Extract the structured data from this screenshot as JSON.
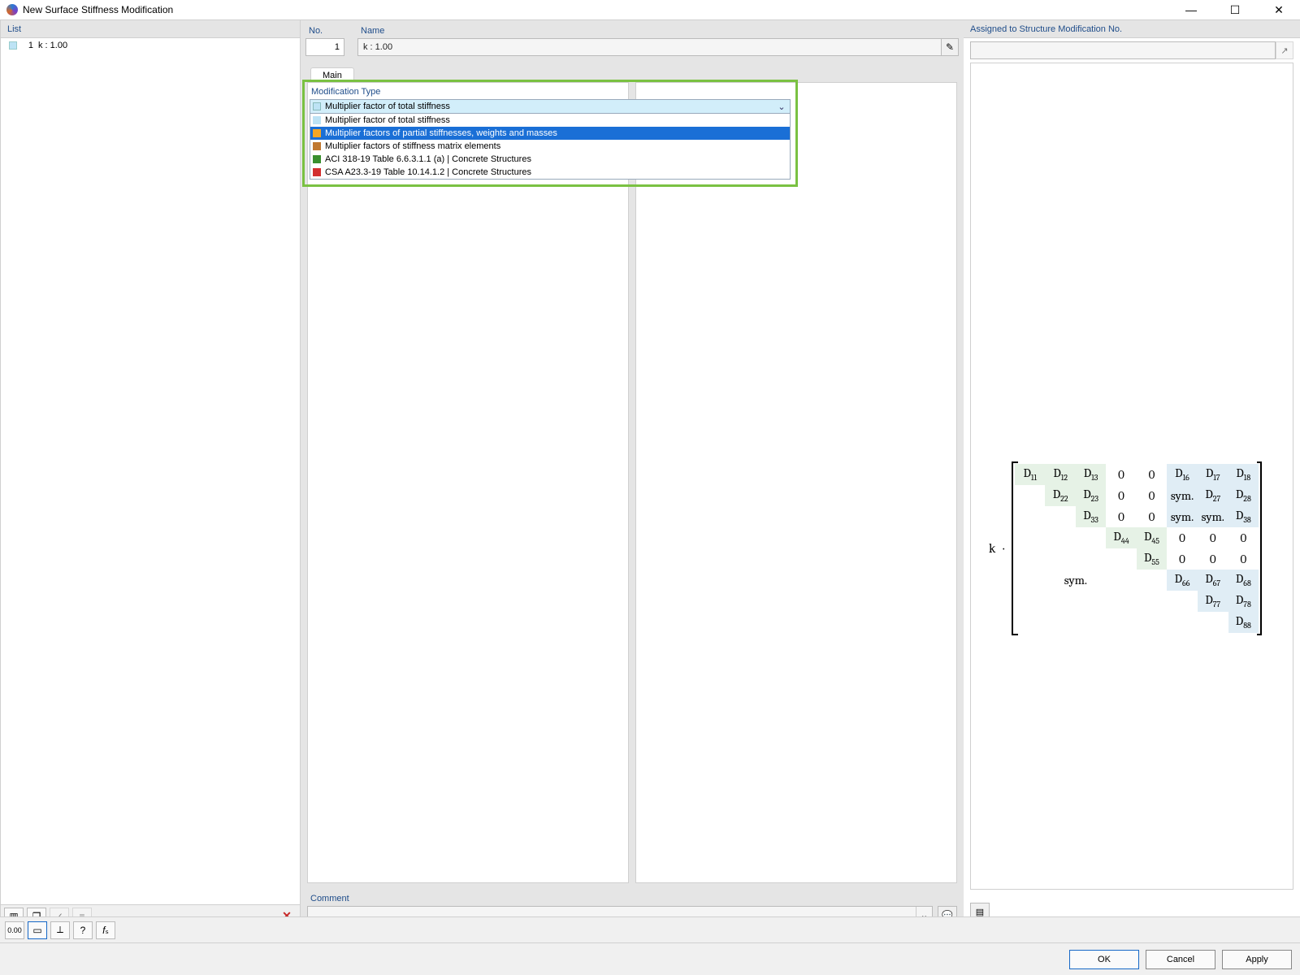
{
  "window": {
    "title": "New Surface Stiffness Modification"
  },
  "sidebar": {
    "header": "List",
    "items": [
      {
        "idx": "1",
        "label": "k : 1.00"
      }
    ],
    "bottom": {
      "new": "new",
      "copy": "copy",
      "check": "check",
      "other": "other",
      "delete": "✕"
    }
  },
  "fields": {
    "no_label": "No.",
    "no_value": "1",
    "name_label": "Name",
    "name_value": "k : 1.00"
  },
  "tabs": {
    "main": "Main"
  },
  "modType": {
    "group_title": "Modification Type",
    "selected": "Multiplier factor of total stiffness",
    "options": [
      {
        "label": "Multiplier factor of total stiffness",
        "swatch": "sw-lblue"
      },
      {
        "label": "Multiplier factors of partial stiffnesses, weights and masses",
        "swatch": "sw-orange"
      },
      {
        "label": "Multiplier factors of stiffness matrix elements",
        "swatch": "sw-brown"
      },
      {
        "label": "ACI 318-19 Table 6.6.3.1.1 (a) | Concrete Structures",
        "swatch": "sw-green"
      },
      {
        "label": "CSA A23.3-19 Table 10.14.1.2 | Concrete Structures",
        "swatch": "sw-red"
      }
    ]
  },
  "comment": {
    "label": "Comment",
    "value": ""
  },
  "rightPanel": {
    "header": "Assigned to Structure Modification No."
  },
  "matrix": {
    "prefix_k": "k",
    "prefix_dot": "·",
    "cells": {
      "d11": "D",
      "d12": "D",
      "d13": "D",
      "d16": "D",
      "d17": "D",
      "d18": "D",
      "d22": "D",
      "d23": "D",
      "d27": "D",
      "d28": "D",
      "d33": "D",
      "d38": "D",
      "d44": "D",
      "d45": "D",
      "d55": "D",
      "d66": "D",
      "d67": "D",
      "d68": "D",
      "d77": "D",
      "d78": "D",
      "d88": "D",
      "zero": "0",
      "sym": "sym.",
      "symdot": "sym."
    }
  },
  "dialogButtons": {
    "ok": "OK",
    "cancel": "Cancel",
    "apply": "Apply"
  }
}
